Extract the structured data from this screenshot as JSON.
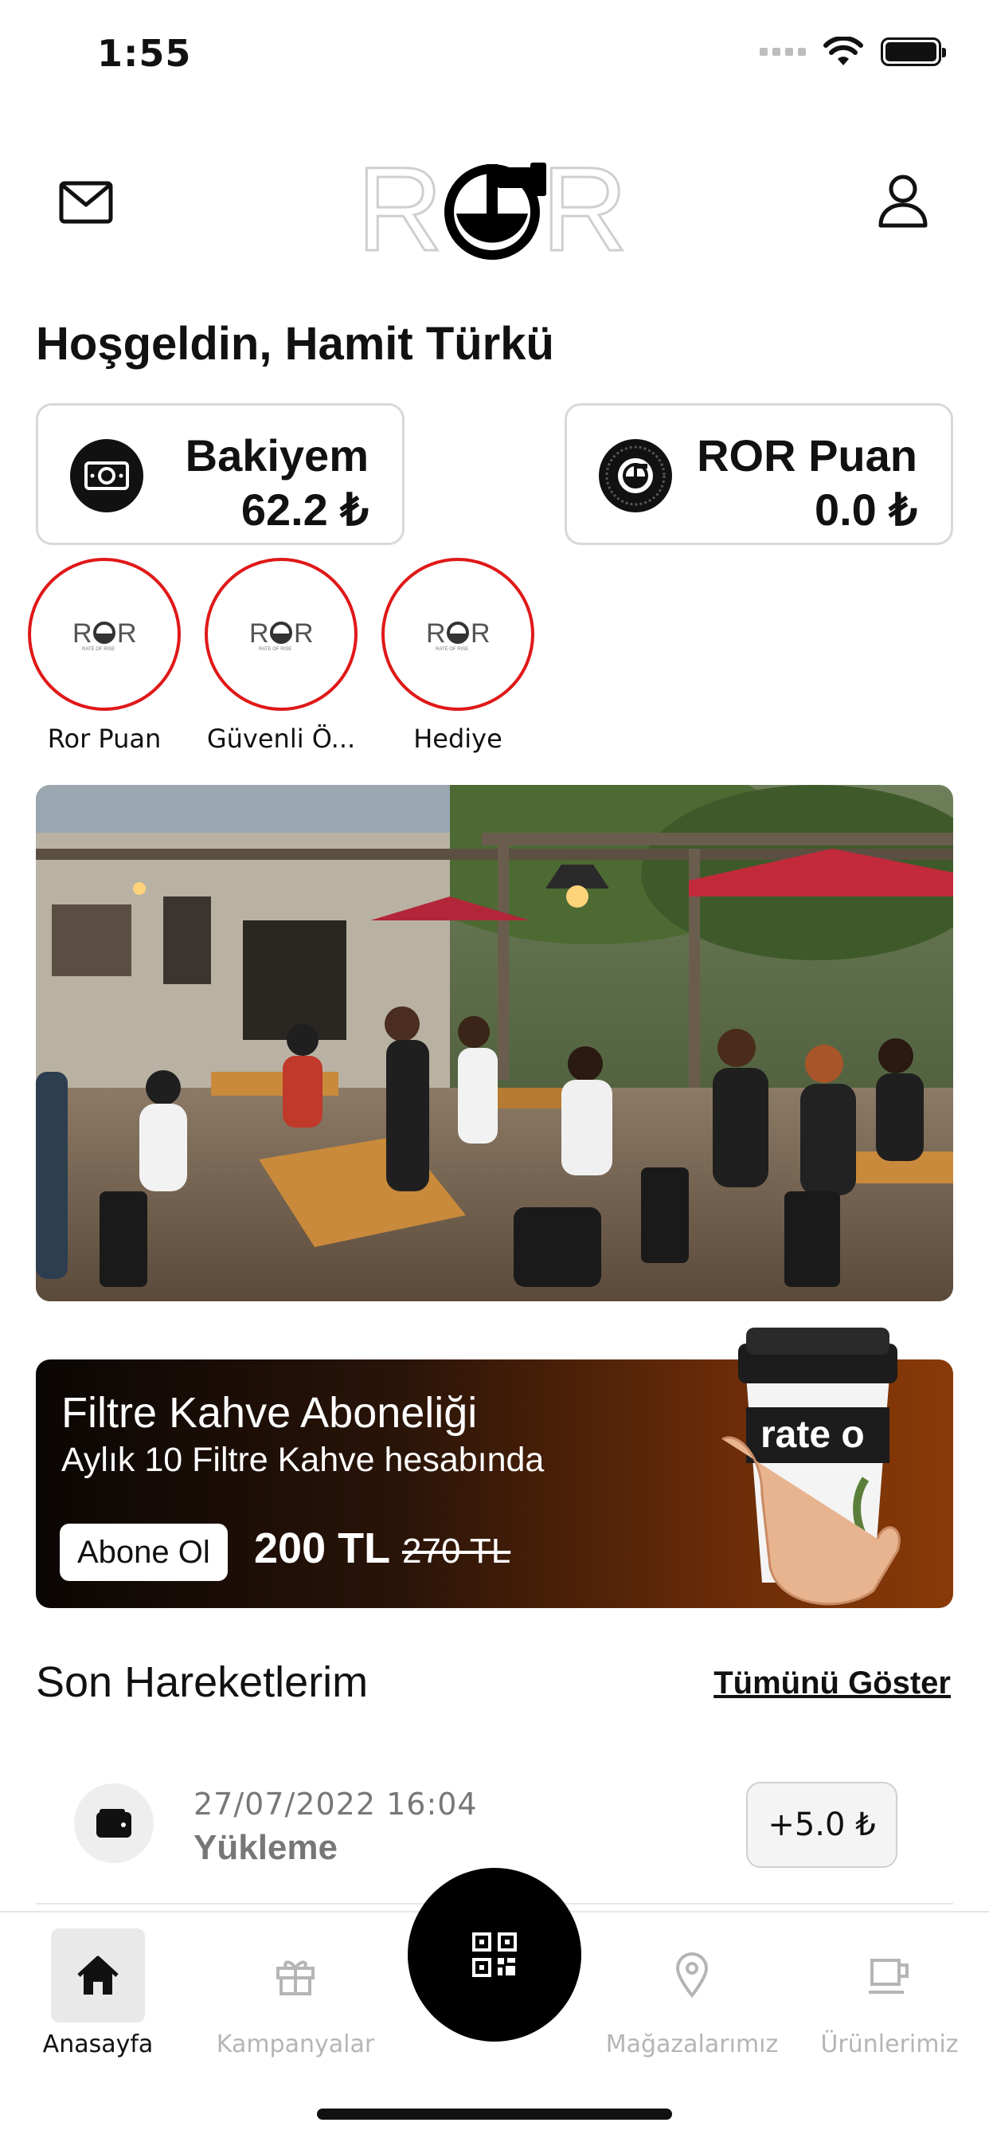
{
  "status_bar": {
    "time": "1:55"
  },
  "header": {
    "logo_text": "ROR"
  },
  "welcome": "Hoşgeldin, Hamit Türkü",
  "cards": [
    {
      "title": "Bakiyem",
      "value": "62.2 ₺",
      "icon": "money-icon"
    },
    {
      "title": "ROR Puan",
      "value": "0.0 ₺",
      "icon": "coin-icon"
    }
  ],
  "stories": [
    {
      "label": "Ror Puan"
    },
    {
      "label": "Güvenli Ö..."
    },
    {
      "label": "Hediye"
    }
  ],
  "promo": {
    "title": "Filtre Kahve Aboneliği",
    "subtitle": "Aylık 10 Filtre Kahve hesabında",
    "button": "Abone Ol",
    "price": "200 TL",
    "old_price": "270 TL"
  },
  "transactions": {
    "title": "Son Hareketlerim",
    "show_all": "Tümünü Göster",
    "items": [
      {
        "date": "27/07/2022 16:04",
        "type": "Yükleme",
        "amount": "+5.0 ₺",
        "icon": "wallet-icon"
      }
    ]
  },
  "tabbar": {
    "tabs": [
      {
        "label": "Anasayfa",
        "icon": "home-icon",
        "active": true
      },
      {
        "label": "Kampanyalar",
        "icon": "gift-icon",
        "active": false
      },
      {
        "label": "Mağazalarımız",
        "icon": "location-pin-icon",
        "active": false
      },
      {
        "label": "Ürünlerimiz",
        "icon": "coffee-cup-icon",
        "active": false
      }
    ],
    "center": {
      "icon": "qr-code-icon"
    }
  },
  "colors": {
    "story_ring": "#e01818",
    "promo_dark": "#0a0604",
    "promo_accent": "#8a3a08"
  }
}
